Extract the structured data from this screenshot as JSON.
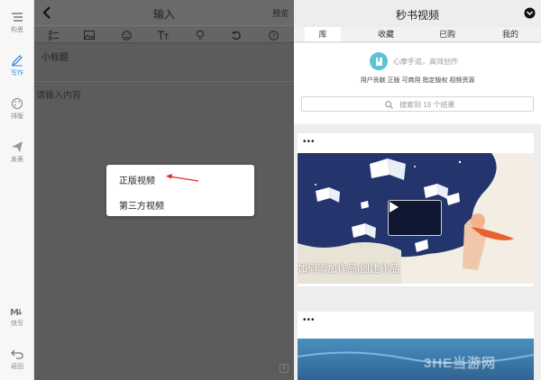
{
  "sidebar": {
    "items": [
      {
        "label": "构思",
        "icon": "outline-icon"
      },
      {
        "label": "写作",
        "icon": "pen-icon"
      },
      {
        "label": "排版",
        "icon": "palette-icon"
      },
      {
        "label": "发表",
        "icon": "send-icon"
      },
      {
        "label": "快写",
        "icon": "markdown-icon"
      },
      {
        "label": "返回",
        "icon": "return-icon"
      }
    ],
    "active_index": 1
  },
  "editor": {
    "title": "输入",
    "preview_label": "预览",
    "subtitle_text": "小标题",
    "content_placeholder": "请输入内容",
    "toolbar_icons": [
      "list-icon",
      "image-icon",
      "emoji-icon",
      "text-format-icon",
      "lightbulb-icon",
      "undo-icon",
      "help-icon"
    ],
    "toolbar_help_glyph": "?",
    "menu": {
      "items": [
        "正版视频",
        "第三方视频"
      ],
      "highlighted": 0
    }
  },
  "panel": {
    "title": "秒书视频",
    "tabs": [
      "库",
      "收藏",
      "已购",
      "我的"
    ],
    "active_tab": 0,
    "slogan": "心摩手追，高效创作",
    "rights_text": "用户贡献 正版 可商用 指定版权 视频资源",
    "search_placeholder": "搜索到 19 个结果",
    "videos": [
      {
        "more": "•••",
        "caption": "如何添加作品|创建作品"
      },
      {
        "more": "•••",
        "caption": ""
      }
    ]
  },
  "watermark": "3HE当游网",
  "colors": {
    "accent": "#3c8be0",
    "editor_bg": "#5c5c5c",
    "panel_bg": "#ededed",
    "logo": "#5cc3d6",
    "arrow": "#e0282a"
  }
}
